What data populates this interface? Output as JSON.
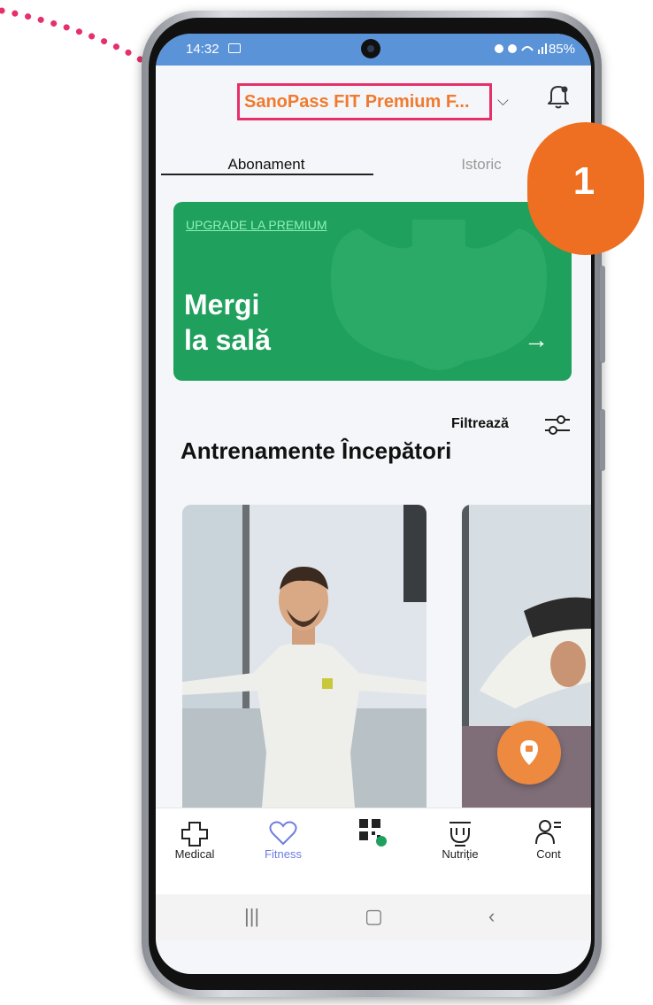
{
  "status_bar": {
    "time": "14:32",
    "battery": "85%"
  },
  "header": {
    "title": "SanoPass FIT Premium F..."
  },
  "tabs": [
    {
      "label": "Abonament",
      "active": true
    },
    {
      "label": "Istoric",
      "active": false
    }
  ],
  "banner": {
    "kicker": "UPGRADE LA PREMIUM",
    "headline_line1": "Mergi",
    "headline_line2": "la sală",
    "arrow": "→",
    "color": "#1fa05c"
  },
  "filter": {
    "label": "Filtrează"
  },
  "section": {
    "title": "Antrenamente Începători"
  },
  "bottom_nav": {
    "items": [
      {
        "label": "Medical",
        "icon": "medical-cross-icon"
      },
      {
        "label": "Fitness",
        "icon": "heart-icon",
        "active": true
      },
      {
        "label": "",
        "icon": "qr-code-icon"
      },
      {
        "label": "Nutriție",
        "icon": "nutrition-bowl-icon"
      },
      {
        "label": "Cont",
        "icon": "account-icon"
      }
    ]
  },
  "annotation": {
    "step_number": "1",
    "highlight_color": "#e6306a",
    "badge_color": "#ee6f21"
  },
  "colors": {
    "accent": "#f07a2e",
    "status_bar": "#5b93d8",
    "active_nav": "#6d7ddf",
    "fab": "#ee8a3f"
  }
}
